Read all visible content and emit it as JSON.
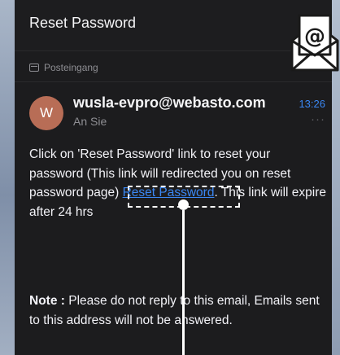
{
  "header": {
    "title": "Reset Password"
  },
  "folder": {
    "label": "Posteingang"
  },
  "email": {
    "avatar_initial": "W",
    "sender": "wusla-evpro@webasto.com",
    "recipient": "An Sie",
    "time": "13:26",
    "more": "···",
    "body_before": "Click on 'Reset Password' link to reset your password (This link will redirected you on reset password page) ",
    "link_text": "Reset Password",
    "body_after": ". This link will expire after 24 hrs",
    "note_label": "Note :",
    "note_text": " Please do not reply to this email, Emails sent to this address will not be answered."
  },
  "colors": {
    "accent": "#3a87f3",
    "background": "#1c1c1e",
    "avatar": "#b86d56"
  },
  "icons": [
    "folder-icon",
    "mail-at-icon"
  ]
}
